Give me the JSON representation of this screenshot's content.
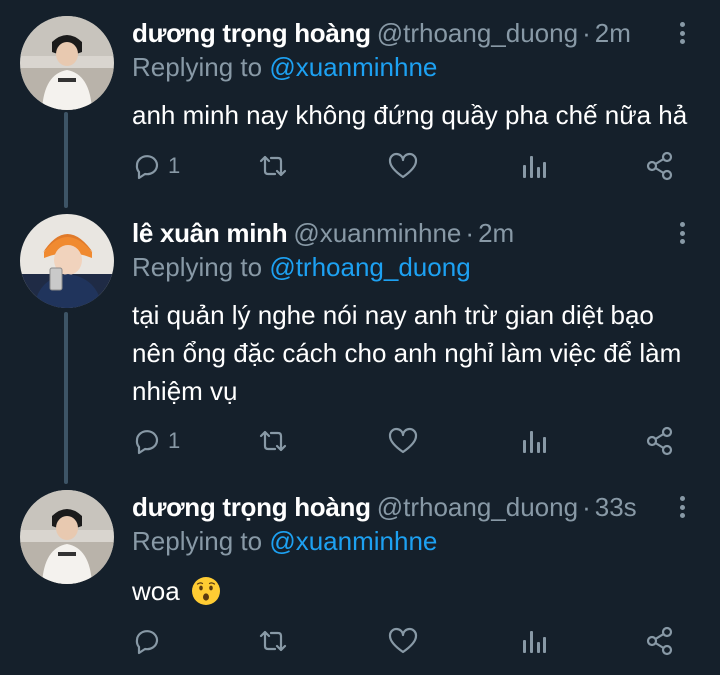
{
  "tweets": [
    {
      "name": "dương trọng hoàng",
      "handle": "@trhoang_duong",
      "separator": "·",
      "time": "2m",
      "reply_prefix": "Replying to",
      "reply_to": "@xuanminhne",
      "text": "anh minh nay không đứng quầy pha chế nữa hả",
      "reply_count": "1"
    },
    {
      "name": "lê xuân minh",
      "handle": "@xuanminhne",
      "separator": "·",
      "time": "2m",
      "reply_prefix": "Replying to",
      "reply_to": "@trhoang_duong",
      "text": "tại quản lý nghe nói nay anh trừ gian diệt bạo nên ổng đặc cách cho anh nghỉ làm việc để làm nhiệm vụ",
      "reply_count": "1"
    },
    {
      "name": "dương trọng hoàng",
      "handle": "@trhoang_duong",
      "separator": "·",
      "time": "33s",
      "reply_prefix": "Replying to",
      "reply_to": "@xuanminhne",
      "text": "woa",
      "emoji": "hushed-face-emoji",
      "reply_count": ""
    }
  ],
  "icons": {
    "reply": "reply-icon",
    "retweet": "retweet-icon",
    "like": "heart-icon",
    "analytics": "analytics-icon",
    "share": "share-icon",
    "more": "more-vertical-icon"
  },
  "colors": {
    "background": "#15202b",
    "secondary_text": "#8899a6",
    "link": "#1da1f2",
    "thread_line": "#3d5466"
  }
}
